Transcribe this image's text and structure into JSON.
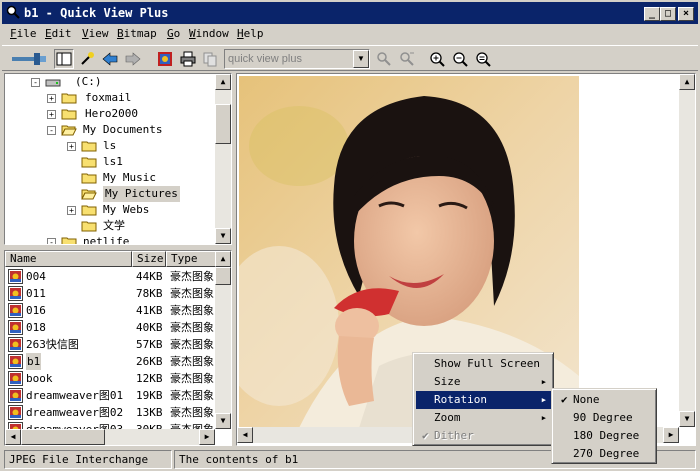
{
  "window": {
    "title": "b1 - Quick View Plus",
    "minimize": "_",
    "maximize": "□",
    "close": "×"
  },
  "menubar": [
    {
      "key": "F",
      "rest": "ile"
    },
    {
      "key": "E",
      "rest": "dit"
    },
    {
      "key": "V",
      "rest": "iew"
    },
    {
      "key": "B",
      "rest": "itmap"
    },
    {
      "key": "G",
      "rest": "o"
    },
    {
      "key": "W",
      "rest": "indow"
    },
    {
      "key": "H",
      "rest": "elp"
    }
  ],
  "toolbar": {
    "address_placeholder": "quick view plus",
    "dropdown_arrow": "▼"
  },
  "tree": {
    "items": [
      {
        "label": "(C:)",
        "expander": "-"
      },
      {
        "label": "foxmail",
        "expander": "+"
      },
      {
        "label": "Hero2000",
        "expander": "+"
      },
      {
        "label": "My Documents",
        "expander": "-"
      },
      {
        "label": "ls",
        "expander": "+"
      },
      {
        "label": "ls1",
        "expander": ""
      },
      {
        "label": "My Music",
        "expander": ""
      },
      {
        "label": "My Pictures",
        "expander": ""
      },
      {
        "label": "My Webs",
        "expander": "+"
      },
      {
        "label": "文学",
        "expander": ""
      },
      {
        "label": "netlife",
        "expander": "-"
      }
    ],
    "scroll_up": "▲",
    "scroll_down": "▼"
  },
  "list": {
    "columns": [
      "Name",
      "Size",
      "Type"
    ],
    "rows": [
      {
        "name": "004",
        "size": "44KB",
        "type": "豪杰图象"
      },
      {
        "name": "011",
        "size": "78KB",
        "type": "豪杰图象"
      },
      {
        "name": "016",
        "size": "41KB",
        "type": "豪杰图象"
      },
      {
        "name": "018",
        "size": "40KB",
        "type": "豪杰图象"
      },
      {
        "name": "263快信图",
        "size": "57KB",
        "type": "豪杰图象"
      },
      {
        "name": "b1",
        "size": "26KB",
        "type": "豪杰图象"
      },
      {
        "name": "book",
        "size": "12KB",
        "type": "豪杰图象"
      },
      {
        "name": "dreamweaver图01",
        "size": "19KB",
        "type": "豪杰图象"
      },
      {
        "name": "dreamweaver图02",
        "size": "13KB",
        "type": "豪杰图象"
      },
      {
        "name": "dreamweaver图03",
        "size": "30KB",
        "type": "豪杰图象"
      }
    ],
    "scroll_up": "▲",
    "scroll_down": "▼",
    "scroll_left": "◀",
    "scroll_right": "▶"
  },
  "viewer": {
    "scroll_up": "▲",
    "scroll_down": "▼",
    "scroll_left": "◀",
    "scroll_right": "▶"
  },
  "context_menu": {
    "items": [
      {
        "label": "Show Full Screen",
        "submenu": false
      },
      {
        "label": "Size",
        "submenu": true
      },
      {
        "label": "Rotation",
        "submenu": true
      },
      {
        "label": "Zoom",
        "submenu": true
      },
      {
        "label": "Dither",
        "check": "✔"
      }
    ],
    "submenu_arrow": "▶"
  },
  "rotation_menu": {
    "items": [
      {
        "label": "None",
        "check": "✔"
      },
      {
        "label": "90 Degree"
      },
      {
        "label": "180 Degree"
      },
      {
        "label": "270 Degree"
      }
    ]
  },
  "status": {
    "file_type": "JPEG File Interchange",
    "description": "The contents of b1"
  },
  "colors": {
    "titlebar": "#0a246a",
    "highlight": "#0a246a",
    "face": "#d4d0c8"
  }
}
